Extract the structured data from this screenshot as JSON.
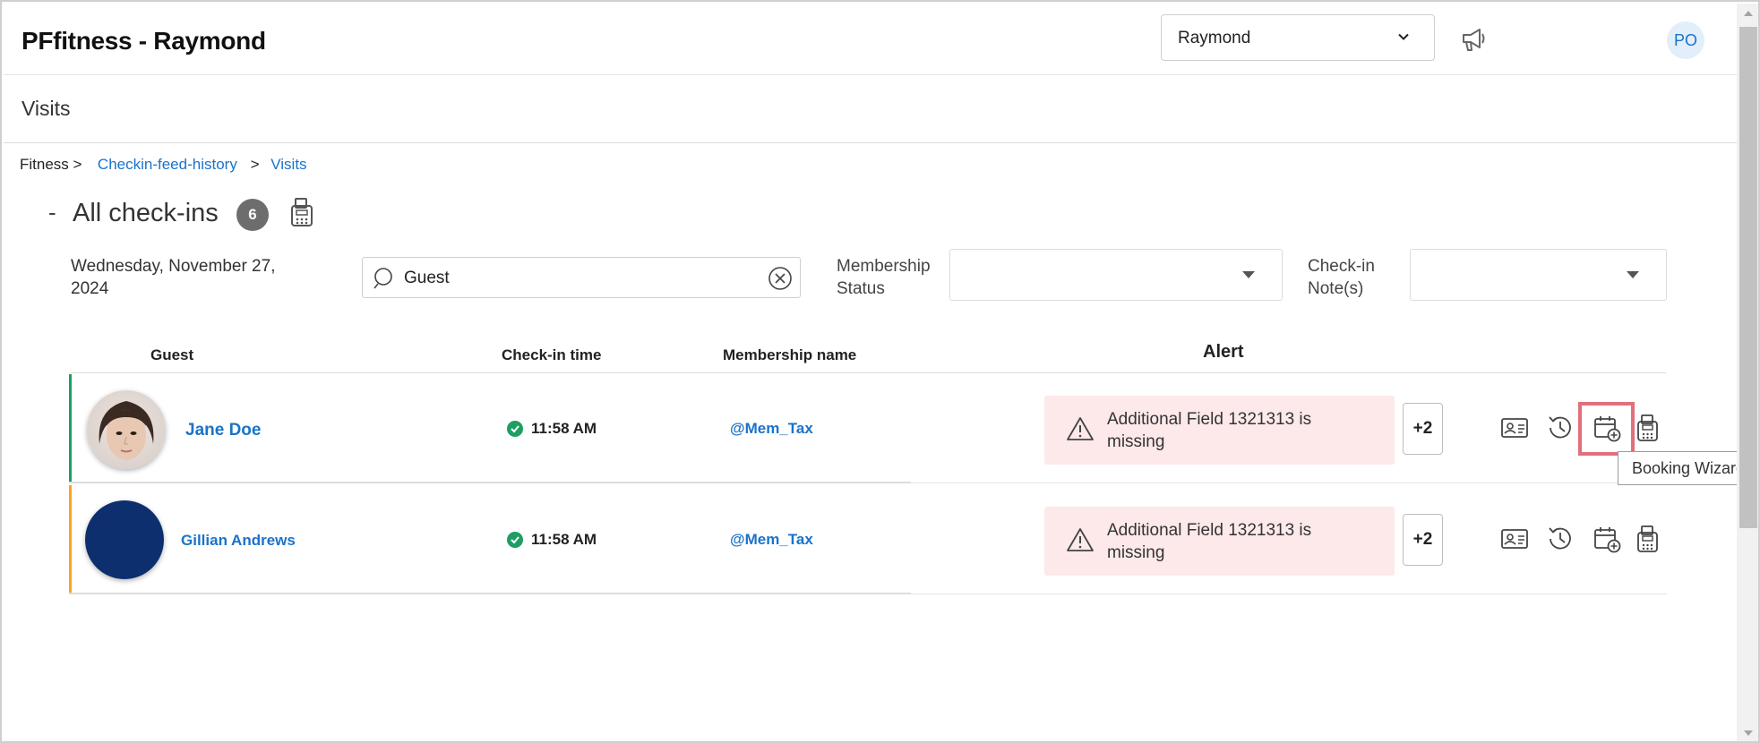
{
  "header": {
    "app_title": "PFfitness - Raymond",
    "location_select": "Raymond",
    "avatar_initials": "PO"
  },
  "subheader": {
    "title": "Visits"
  },
  "breadcrumb": {
    "items": [
      {
        "label": "Fitness >",
        "link": false
      },
      {
        "label": "Checkin-feed-history",
        "link": true
      },
      {
        "label": ">",
        "link": false
      },
      {
        "label": "Visits",
        "link": true
      }
    ]
  },
  "section": {
    "collapse_symbol": "-",
    "title": "All check-ins",
    "count": "6"
  },
  "filters": {
    "date_line1": "Wednesday, November 27,",
    "date_line2": "2024",
    "search_value": "Guest",
    "membership_status_label_line1": "Membership",
    "membership_status_label_line2": "Status",
    "membership_status_value": "",
    "checkin_notes_label_line1": "Check-in",
    "checkin_notes_label_line2": "Note(s)",
    "checkin_notes_value": ""
  },
  "table": {
    "columns": {
      "guest": "Guest",
      "checkin_time": "Check-in time",
      "membership_name": "Membership name",
      "alert": "Alert"
    },
    "rows": [
      {
        "name": "Jane Doe",
        "time": "11:58 AM",
        "membership": "@Mem_Tax",
        "alert_line1": "Additional Field 1321313 is",
        "alert_line2": "missing",
        "more": "+2",
        "accent_color": "#1e9e63",
        "avatar": "photo"
      },
      {
        "name": "Gillian Andrews",
        "time": "11:58 AM",
        "membership": "@Mem_Tax",
        "alert_line1": "Additional Field 1321313 is",
        "alert_line2": "missing",
        "more": "+2",
        "accent_color": "#f5a623",
        "avatar": "navy-circle"
      }
    ]
  },
  "tooltip": {
    "text": "Booking Wizard"
  },
  "colors": {
    "link": "#1a73c9",
    "alert_bg": "#fde9ea",
    "highlight": "#e0707c",
    "avatar_navy": "#0d2f6e"
  },
  "icons": [
    "chevron-down-icon",
    "megaphone-icon",
    "pos-terminal-icon",
    "search-icon",
    "clear-icon",
    "warning-icon",
    "id-card-icon",
    "history-icon",
    "calendar-add-icon"
  ]
}
